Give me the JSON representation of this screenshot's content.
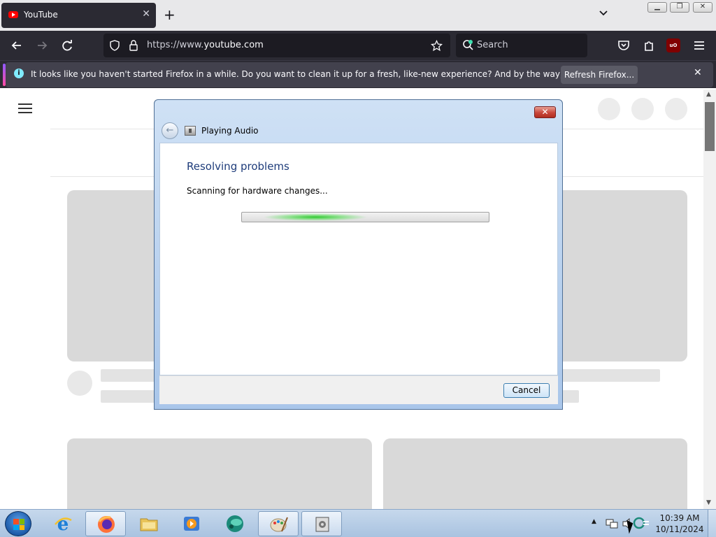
{
  "browser": {
    "tab": {
      "title": "YouTube",
      "close_icon": "close-icon"
    },
    "new_tab_label": "+",
    "url": {
      "prefix": "https://www.",
      "domain": "youtube.com"
    },
    "search": {
      "placeholder": "Search"
    },
    "notification": {
      "info_glyph": "i",
      "text": "It looks like you haven't started Firefox in a while. Do you want to clean it up for a fresh, like-new experience? And by the way, welcome back!",
      "button_label": "Refresh Firefox...",
      "close_glyph": "✕"
    }
  },
  "dialog": {
    "title": "Playing Audio",
    "heading": "Resolving problems",
    "status": "Scanning for hardware changes...",
    "cancel_label": "Cancel",
    "close_glyph": "✕"
  },
  "taskbar": {
    "items": [
      "windows-start",
      "internet-explorer",
      "firefox",
      "file-explorer",
      "media-player",
      "app-teal",
      "paint",
      "troubleshooter"
    ],
    "clock": {
      "time": "10:39 AM",
      "date": "10/11/2024"
    }
  },
  "colors": {
    "firefox_dark": "#2b2a33",
    "dialog_heading": "#1e3c7a",
    "progress_glow": "#28c828"
  }
}
